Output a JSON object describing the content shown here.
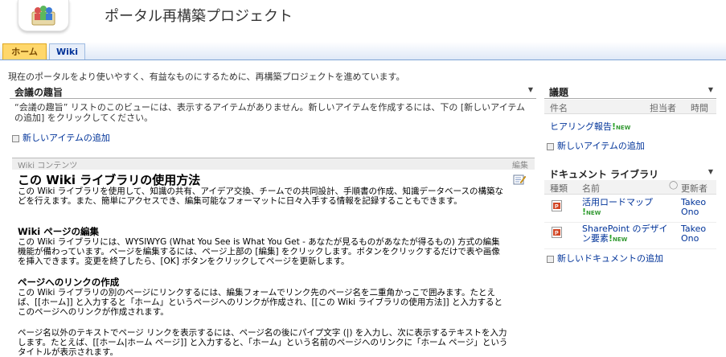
{
  "site": {
    "title": "ポータル再構築プロジェクト"
  },
  "tabs": [
    {
      "label": "ホーム"
    },
    {
      "label": "Wiki"
    }
  ],
  "intro": "現在のポータルをより使いやすく、有益なものにするために、再構築プロジェクトを進めています。",
  "meeting": {
    "title": "会議の趣旨",
    "empty_message": "“会議の趣旨” リストのこのビューには、表示するアイテムがありません。新しいアイテムを作成するには、下の [新しいアイテムの追加] をクリックしてください。",
    "add_link": "新しいアイテムの追加"
  },
  "wiki": {
    "header_label": "Wiki コンテンツ",
    "edit_label": "編集",
    "h1": "この Wiki ライブラリの使用方法",
    "p1": "この Wiki ライブラリを使用して、知識の共有、アイデア交換、チームでの共同設計、手順書の作成、知識データベースの構築などを行えます。また、簡単にアクセスでき、編集可能なフォーマットに日々入手する情報を記録することもできます。",
    "h2a": "Wiki ページの編集",
    "p2": "この Wiki ライブラリには、WYSIWYG (What You See is What You Get - あなたが見るものがあなたが得るもの) 方式の編集機能が備わっています。ページを編集するには、ページ上部の [編集] をクリックします。ボタンをクリックするだけで表や画像を挿入できます。変更を終了したら、[OK] ボタンをクリックしてページを更新します。",
    "h2b": "ページへのリンクの作成",
    "p3": "この Wiki ライブラリの別のページにリンクするには、編集フォームでリンク先のページ名を二重角かっこで囲みます。たとえば、[[ホーム]] と入力すると「ホーム」というページへのリンクが作成され、[[この Wiki ライブラリの使用方法]] と入力するとこのページへのリンクが作成されます。",
    "p4": "ページ名以外のテキストでページ リンクを表示するには、ページ名の後にパイプ文字 (|) を入力し、次に表示するテキストを入力します。たとえば、[[ホーム|ホーム ページ]] と入力すると、「ホーム」という名前のページへのリンクに「ホーム ページ」というタイトルが表示されます。"
  },
  "agenda": {
    "title": "議題",
    "columns": [
      "件名",
      "担当者",
      "時間"
    ],
    "item": "ヒアリング報告",
    "new_badge": "NEW",
    "add_link": "新しいアイテムの追加"
  },
  "docs": {
    "title": "ドキュメント ライブラリ",
    "columns": [
      "種類",
      "名前",
      "更新者"
    ],
    "items": [
      {
        "name": "活用ロードマップ",
        "modified_by": "Takeo Ono",
        "new_badge": "NEW"
      },
      {
        "name": "SharePoint のデザイン要素",
        "modified_by": "Takeo Ono",
        "new_badge": "NEW"
      }
    ],
    "add_link": "新しいドキュメントの追加"
  }
}
